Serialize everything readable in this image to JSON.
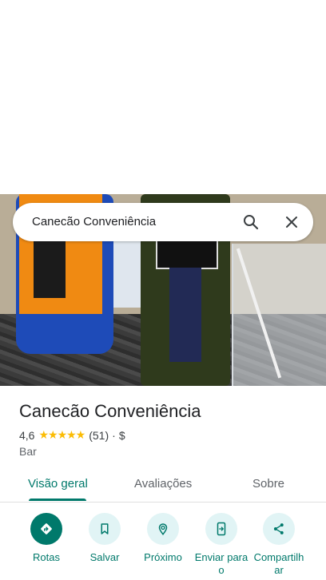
{
  "search": {
    "query": "Canecão Conveniência"
  },
  "place": {
    "name": "Canecão Conveniência",
    "rating": "4,6",
    "stars": "★★★★★",
    "review_count": "(51)",
    "separator": "·",
    "price": "$",
    "category": "Bar"
  },
  "tabs": [
    {
      "label": "Visão geral",
      "active": true
    },
    {
      "label": "Avaliações",
      "active": false
    },
    {
      "label": "Sobre",
      "active": false
    }
  ],
  "actions": [
    {
      "label": "Rotas",
      "icon": "directions-icon"
    },
    {
      "label": "Salvar",
      "icon": "bookmark-icon"
    },
    {
      "label": "Próximo",
      "icon": "nearby-icon"
    },
    {
      "label": "Enviar para o",
      "icon": "send-to-phone-icon"
    },
    {
      "label": "Compartilhar",
      "icon": "share-icon"
    }
  ],
  "colors": {
    "accent": "#00796b",
    "action_bg": "#e1f4f5",
    "star": "#fbbc04"
  }
}
